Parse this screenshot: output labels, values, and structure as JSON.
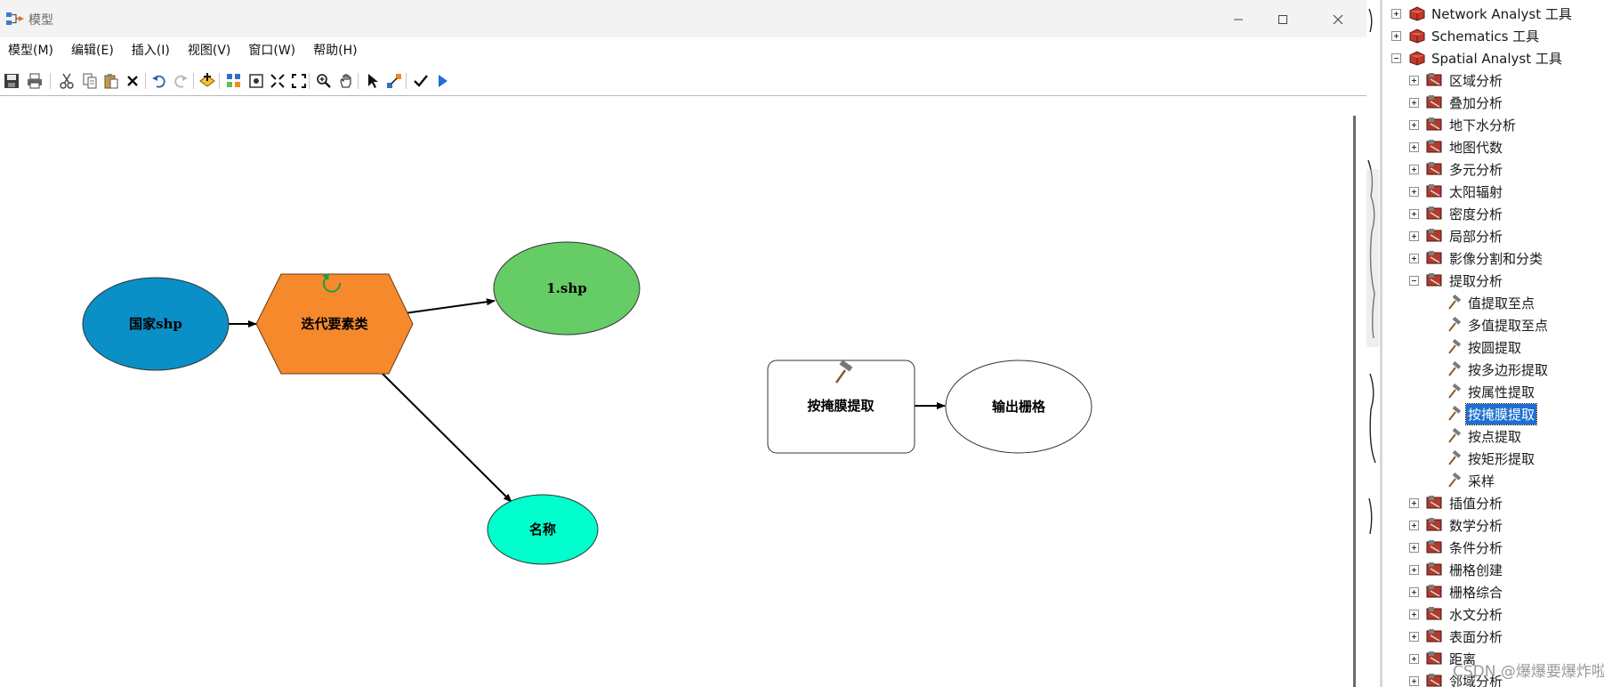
{
  "window": {
    "title": "模型",
    "controls": [
      "minimize",
      "maximize",
      "close"
    ]
  },
  "menu": [
    {
      "label": "模型(M)"
    },
    {
      "label": "编辑(E)"
    },
    {
      "label": "插入(I)"
    },
    {
      "label": "视图(V)"
    },
    {
      "label": "窗口(W)"
    },
    {
      "label": "帮助(H)"
    }
  ],
  "toolbar": {
    "icons": [
      "save-icon",
      "print-icon",
      "cut-icon",
      "copy-icon",
      "paste-icon",
      "delete-icon",
      "undo-icon",
      "redo-icon",
      "add-data-icon",
      "auto-layout-icon",
      "full-extent-icon",
      "fixed-zoom-in-icon",
      "fixed-zoom-out-icon",
      "zoom-in-icon",
      "pan-icon",
      "select-icon",
      "add-connection-icon",
      "validate-icon",
      "run-icon"
    ]
  },
  "model": {
    "nodes": {
      "country": {
        "label": "国家shp",
        "shape": "ellipse",
        "color": "#0a8fc7"
      },
      "iterator": {
        "label": "迭代要素类",
        "shape": "hexagon",
        "color": "#f5892c"
      },
      "output1": {
        "label": "1.shp",
        "shape": "ellipse",
        "color": "#66cc66"
      },
      "name": {
        "label": "名称",
        "shape": "ellipse",
        "color": "#00ffcc"
      },
      "extract": {
        "label": "按掩膜提取",
        "shape": "rounded-rect",
        "color": "#ffffff"
      },
      "raster": {
        "label": "输出栅格",
        "shape": "ellipse",
        "color": "#ffffff"
      }
    }
  },
  "toolbox": {
    "items": [
      {
        "label": "Network Analyst 工具",
        "level": 0,
        "expander": "plus",
        "icon": "toolbox-icon"
      },
      {
        "label": "Schematics 工具",
        "level": 0,
        "expander": "plus",
        "icon": "toolbox-icon"
      },
      {
        "label": "Spatial Analyst 工具",
        "level": 0,
        "expander": "minus",
        "icon": "toolbox-icon"
      },
      {
        "label": "区域分析",
        "level": 1,
        "expander": "plus",
        "icon": "toolset-icon"
      },
      {
        "label": "叠加分析",
        "level": 1,
        "expander": "plus",
        "icon": "toolset-icon"
      },
      {
        "label": "地下水分析",
        "level": 1,
        "expander": "plus",
        "icon": "toolset-icon"
      },
      {
        "label": "地图代数",
        "level": 1,
        "expander": "plus",
        "icon": "toolset-icon"
      },
      {
        "label": "多元分析",
        "level": 1,
        "expander": "plus",
        "icon": "toolset-icon"
      },
      {
        "label": "太阳辐射",
        "level": 1,
        "expander": "plus",
        "icon": "toolset-icon"
      },
      {
        "label": "密度分析",
        "level": 1,
        "expander": "plus",
        "icon": "toolset-icon"
      },
      {
        "label": "局部分析",
        "level": 1,
        "expander": "plus",
        "icon": "toolset-icon"
      },
      {
        "label": "影像分割和分类",
        "level": 1,
        "expander": "plus",
        "icon": "toolset-icon"
      },
      {
        "label": "提取分析",
        "level": 1,
        "expander": "minus",
        "icon": "toolset-icon"
      },
      {
        "label": "值提取至点",
        "level": 2,
        "expander": "none",
        "icon": "hammer-icon"
      },
      {
        "label": "多值提取至点",
        "level": 2,
        "expander": "none",
        "icon": "hammer-icon"
      },
      {
        "label": "按圆提取",
        "level": 2,
        "expander": "none",
        "icon": "hammer-icon"
      },
      {
        "label": "按多边形提取",
        "level": 2,
        "expander": "none",
        "icon": "hammer-icon"
      },
      {
        "label": "按属性提取",
        "level": 2,
        "expander": "none",
        "icon": "hammer-icon"
      },
      {
        "label": "按掩膜提取",
        "level": 2,
        "expander": "none",
        "icon": "hammer-icon",
        "selected": true
      },
      {
        "label": "按点提取",
        "level": 2,
        "expander": "none",
        "icon": "hammer-icon"
      },
      {
        "label": "按矩形提取",
        "level": 2,
        "expander": "none",
        "icon": "hammer-icon"
      },
      {
        "label": "采样",
        "level": 2,
        "expander": "none",
        "icon": "hammer-icon"
      },
      {
        "label": "插值分析",
        "level": 1,
        "expander": "plus",
        "icon": "toolset-icon"
      },
      {
        "label": "数学分析",
        "level": 1,
        "expander": "plus",
        "icon": "toolset-icon"
      },
      {
        "label": "条件分析",
        "level": 1,
        "expander": "plus",
        "icon": "toolset-icon"
      },
      {
        "label": "栅格创建",
        "level": 1,
        "expander": "plus",
        "icon": "toolset-icon"
      },
      {
        "label": "栅格综合",
        "level": 1,
        "expander": "plus",
        "icon": "toolset-icon"
      },
      {
        "label": "水文分析",
        "level": 1,
        "expander": "plus",
        "icon": "toolset-icon"
      },
      {
        "label": "表面分析",
        "level": 1,
        "expander": "plus",
        "icon": "toolset-icon"
      },
      {
        "label": "距离",
        "level": 1,
        "expander": "plus",
        "icon": "toolset-icon"
      },
      {
        "label": "邻域分析",
        "level": 1,
        "expander": "plus",
        "icon": "toolset-icon"
      }
    ]
  },
  "watermark": "CSDN @爆爆要爆炸啦"
}
